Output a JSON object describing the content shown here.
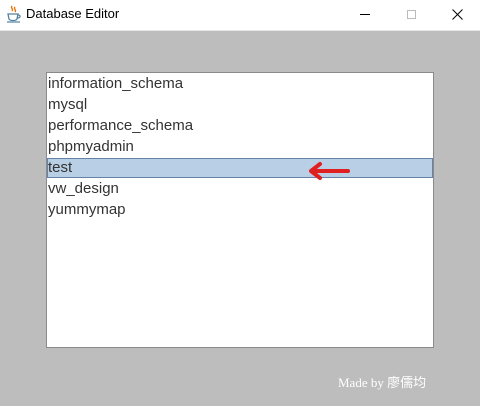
{
  "window": {
    "title": "Database Editor",
    "app_icon": "java-coffee-cup-icon",
    "controls": {
      "minimize_icon": "minimize-icon",
      "maximize_icon": "maximize-icon",
      "close_icon": "close-icon"
    }
  },
  "database_list": {
    "items": [
      {
        "label": "information_schema",
        "selected": false
      },
      {
        "label": "mysql",
        "selected": false
      },
      {
        "label": "performance_schema",
        "selected": false
      },
      {
        "label": "phpmyadmin",
        "selected": false
      },
      {
        "label": "test",
        "selected": true
      },
      {
        "label": "vw_design",
        "selected": false
      },
      {
        "label": "yummymap",
        "selected": false
      }
    ]
  },
  "annotation": {
    "icon": "red-arrow-left-icon",
    "color": "#e02020"
  },
  "footer": {
    "credit": "Made by 廖儒均"
  },
  "colors": {
    "background": "#bdbdbd",
    "selection": "#b8cfe5",
    "selection_border": "#6382a6"
  }
}
